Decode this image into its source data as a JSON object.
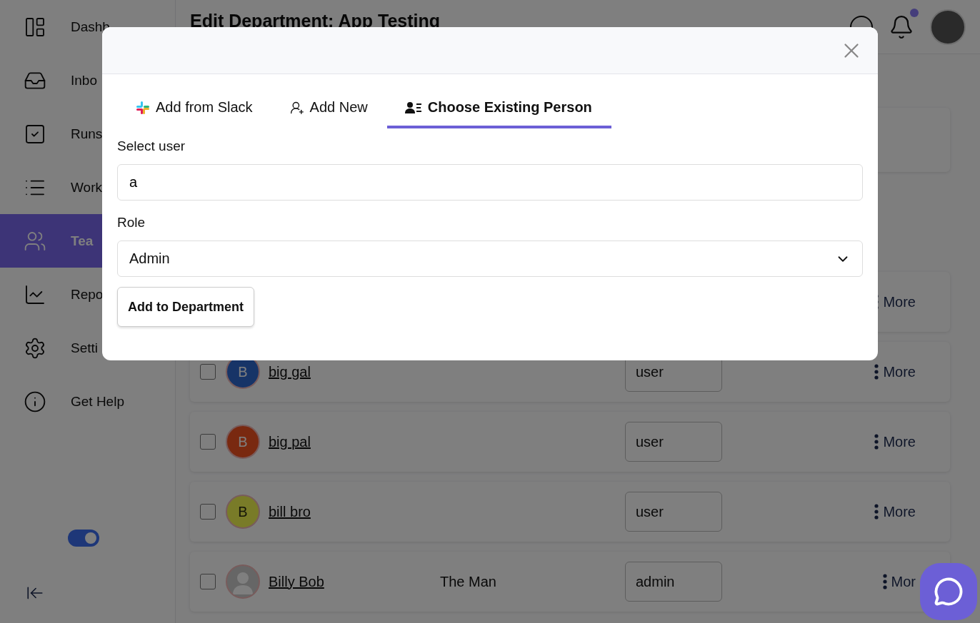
{
  "sidebar": {
    "items": [
      {
        "label": "Dashb",
        "selected": false
      },
      {
        "label": "Inbo",
        "selected": false
      },
      {
        "label": "Runs",
        "selected": false
      },
      {
        "label": "Work",
        "selected": false
      },
      {
        "label": "Tea",
        "selected": true
      },
      {
        "label": "Repo",
        "selected": false
      },
      {
        "label": "Setti",
        "selected": false
      },
      {
        "label": "Get Help",
        "selected": false
      }
    ],
    "toggle": {
      "on": true
    }
  },
  "header": {
    "title": "Edit Department: App Testing",
    "unread": true
  },
  "members": [
    {
      "kind": "hidden",
      "more": "More"
    },
    {
      "kind": "initial",
      "checked": false,
      "initial": "B",
      "color": "#1a3a72",
      "name": "big gal",
      "role": "user",
      "more": "More"
    },
    {
      "kind": "initial",
      "checked": false,
      "initial": "B",
      "color": "#852d12",
      "name": "big pal",
      "role": "user",
      "more": "More"
    },
    {
      "kind": "initial",
      "checked": false,
      "initial": "B",
      "color": "#85882c",
      "name": "bill bro",
      "role": "user",
      "more": "More"
    },
    {
      "kind": "photo",
      "checked": false,
      "name": "Billy Bob",
      "title": "The Man",
      "role": "admin",
      "more": "Mor"
    }
  ],
  "modal": {
    "tabs": [
      {
        "label": "Add from Slack",
        "selected": false
      },
      {
        "label": "Add New",
        "selected": false
      },
      {
        "label": "Choose Existing Person",
        "selected": true
      }
    ],
    "user_label": "Select user",
    "user_value": "a",
    "role_label": "Role",
    "role_value": "Admin",
    "submit": "Add to Department"
  }
}
